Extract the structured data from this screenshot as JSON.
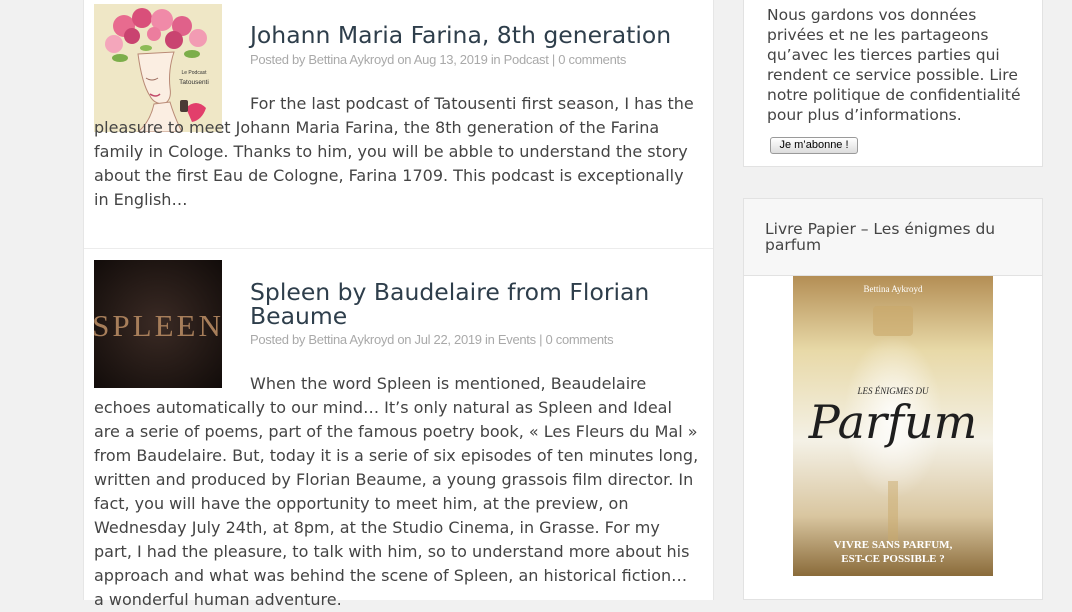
{
  "posts": [
    {
      "title": "Johann Maria Farina, 8th generation",
      "meta": "Posted by Bettina Aykroyd on Aug 13, 2019 in Podcast | 0 comments",
      "thumb_caption_1": "Le Podcast",
      "thumb_caption_2": "Tatousenti",
      "excerpt": "For the last podcast of  Tatousenti first season, I has the pleasure to meet Johann Maria Farina, the 8th generation of the Farina family in Cologe. Thanks to him, you will be abble to understand the story about the first Eau de Cologne, Farina 1709. This podcast is exceptionally in English…"
    },
    {
      "title": "Spleen by Baudelaire from Florian Beaume",
      "meta": "Posted by Bettina Aykroyd on Jul 22, 2019 in Events | 0 comments",
      "thumb_text": "SPLEEN",
      "excerpt": "When the word Spleen is mentioned, Beaudelaire echoes automatically to our mind… It’s only natural as Spleen and Ideal are a serie of poems, part of the famous poetry book, « Les Fleurs du Mal » from Baudelaire. But, today it is a serie of six episodes of ten minutes long, written and produced by Florian Beaume, a young grassois film director. In fact, you will have the opportunity to meet him, at the preview, on Wednesday July 24th, at 8pm, at the Studio Cinema, in Grasse. For my part, I had the pleasure, to talk with him, so to understand more about  his approach and what was  behind the scene of Spleen, an historical fiction… a wonderful human adventure."
    }
  ],
  "subscribe": {
    "text": "Nous gardons vos données privées et ne les partageons qu’avec les tierces parties qui rendent ce service possible. Lire notre politique de confidentialité pour plus d’informations.",
    "button_label": "Je m’abonne !"
  },
  "book_widget": {
    "title": "Livre Papier – Les énigmes du parfum",
    "cover_author": "Bettina Aykroyd",
    "cover_title_1": "LES ÉNIGMES DU",
    "cover_title_2": "Parfum",
    "cover_tagline_1": "VIVRE SANS PARFUM,",
    "cover_tagline_2": "EST-CE POSSIBLE ?"
  }
}
